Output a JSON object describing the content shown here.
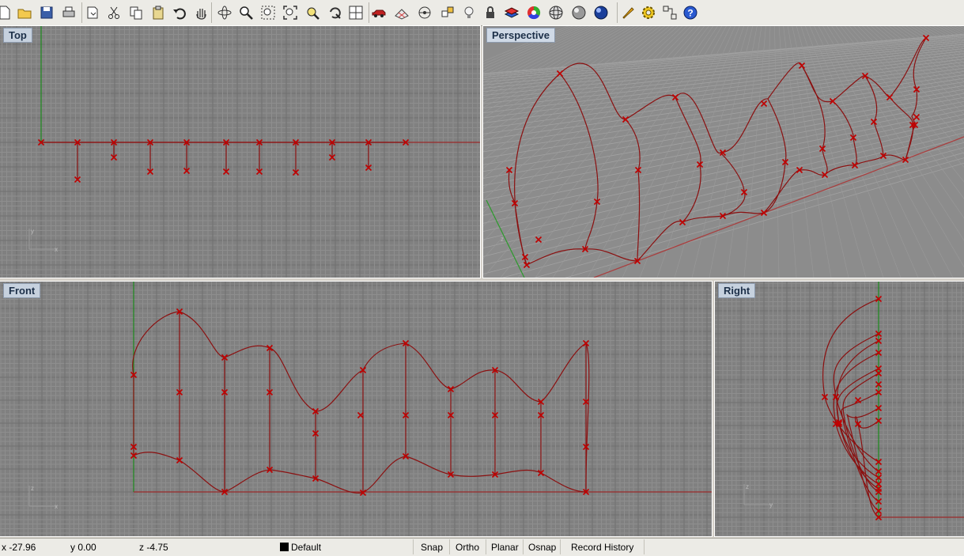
{
  "toolbar": {
    "buttons": [
      {
        "name": "new-icon"
      },
      {
        "name": "open-folder-icon"
      },
      {
        "name": "save-icon"
      },
      {
        "name": "print-icon"
      },
      {
        "name": "import-icon"
      },
      {
        "name": "cut-icon"
      },
      {
        "name": "copy-icon"
      },
      {
        "name": "paste-icon"
      },
      {
        "name": "undo-icon"
      },
      {
        "name": "pan-hand-icon"
      },
      {
        "name": "rotate-view-icon"
      },
      {
        "name": "zoom-icon"
      },
      {
        "name": "zoom-window-icon"
      },
      {
        "name": "zoom-extents-icon"
      },
      {
        "name": "zoom-selected-icon"
      },
      {
        "name": "undo-view-icon"
      },
      {
        "name": "four-viewports-icon"
      },
      {
        "name": "car-icon"
      },
      {
        "name": "cplane-grid-icon"
      },
      {
        "name": "point-icon"
      },
      {
        "name": "osnap-icon"
      },
      {
        "name": "light-bulb-icon"
      },
      {
        "name": "lock-icon"
      },
      {
        "name": "layer-icon"
      },
      {
        "name": "color-wheel-icon"
      },
      {
        "name": "wireframe-sphere-icon"
      },
      {
        "name": "shaded-sphere-icon"
      },
      {
        "name": "rendered-sphere-icon"
      },
      {
        "name": "highlighter-icon"
      },
      {
        "name": "gear-icon"
      },
      {
        "name": "group-icon"
      },
      {
        "name": "help-icon"
      }
    ]
  },
  "viewports": {
    "top": {
      "title": "Top"
    },
    "perspective": {
      "title": "Perspective"
    },
    "front": {
      "title": "Front"
    },
    "right": {
      "title": "Right"
    }
  },
  "axis_labels": {
    "top_y": "y",
    "top_x": "x",
    "persp_z": "z",
    "front_z": "z",
    "front_x": "x",
    "right_z": "z",
    "right_y": "y"
  },
  "status": {
    "x": "x -27.96",
    "y": "y 0.00",
    "z": "z -4.75",
    "layer": "Default",
    "snap": "Snap",
    "ortho": "Ortho",
    "planar": "Planar",
    "osnap": "Osnap",
    "record_history": "Record History"
  },
  "colors": {
    "viewport_bg": "#808080",
    "grid": "#8e8e8e",
    "curve": "#8b1010",
    "control_point": "#c00000",
    "x_axis": "#9a2a2a",
    "y_axis": "#1c8a1c"
  }
}
